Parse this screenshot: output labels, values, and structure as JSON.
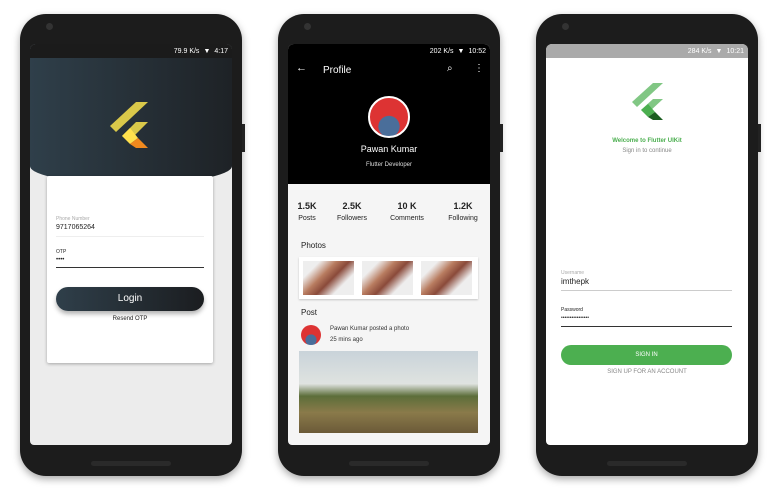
{
  "phone1": {
    "status": {
      "speed": "79.9 K/s",
      "time": "4:17"
    },
    "phone_label": "Phone Number",
    "phone_value": "9717065264",
    "otp_label": "OTP",
    "otp_value": "••••",
    "login_label": "Login",
    "resend_label": "Resend OTP",
    "colors": {
      "dark": "#2f3f4a",
      "logo_yellow": "#d9c84a",
      "logo_orange": "#f0891e"
    }
  },
  "phone2": {
    "status": {
      "speed": "202 K/s",
      "time": "10:52"
    },
    "title": "Profile",
    "name": "Pawan Kumar",
    "role": "Flutter Developer",
    "stats": [
      {
        "value": "1.5K",
        "label": "Posts"
      },
      {
        "value": "2.5K",
        "label": "Followers"
      },
      {
        "value": "10 K",
        "label": "Comments"
      },
      {
        "value": "1.2K",
        "label": "Following"
      }
    ],
    "photos_title": "Photos",
    "post_title": "Post",
    "post_text": "Pawan Kumar posted a photo",
    "post_time": "25 mins ago"
  },
  "phone3": {
    "status": {
      "speed": "284 K/s",
      "time": "10:21"
    },
    "welcome": "Welcome to Flutter UIKit",
    "subtitle": "Sign in to continue",
    "username_label": "Username",
    "username_value": "imthepk",
    "password_label": "Password",
    "password_value": "••••••••••••••••",
    "signin_label": "SIGN IN",
    "signup_label": "SIGN UP FOR AN ACCOUNT",
    "colors": {
      "green": "#4caf50"
    }
  }
}
